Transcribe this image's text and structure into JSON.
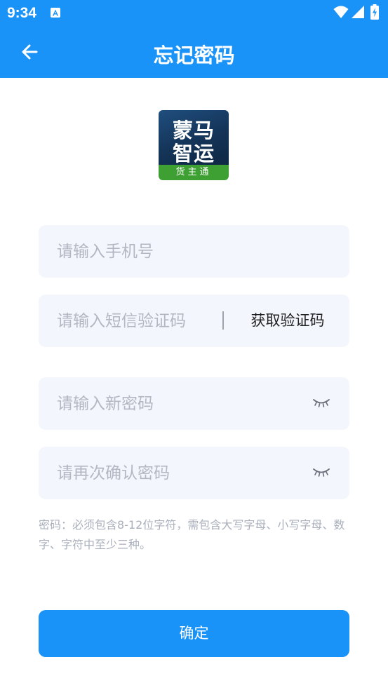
{
  "status_bar": {
    "time": "9:34",
    "icons": [
      "notification-a-icon",
      "wifi-icon",
      "signal-icon",
      "battery-charging-icon"
    ]
  },
  "app_bar": {
    "title": "忘记密码",
    "back_icon": "arrow-left-icon"
  },
  "logo": {
    "line1": "蒙马",
    "line2": "智运",
    "subtitle": "货主通"
  },
  "form": {
    "phone_placeholder": "请输入手机号",
    "sms_code_placeholder": "请输入短信验证码",
    "get_code_label": "获取验证码",
    "new_password_placeholder": "请输入新密码",
    "confirm_password_placeholder": "请再次确认密码",
    "eye_icon": "eye-closed-icon"
  },
  "hint": "密码：必须包含8-12位字符，需包含大写字母、小写字母、数字、字符中至少三种。",
  "confirm_label": "确定",
  "colors": {
    "primary": "#1a93f8",
    "field_bg": "#f3f6fd",
    "placeholder": "#b3b7c2",
    "hint": "#aab0bc"
  }
}
